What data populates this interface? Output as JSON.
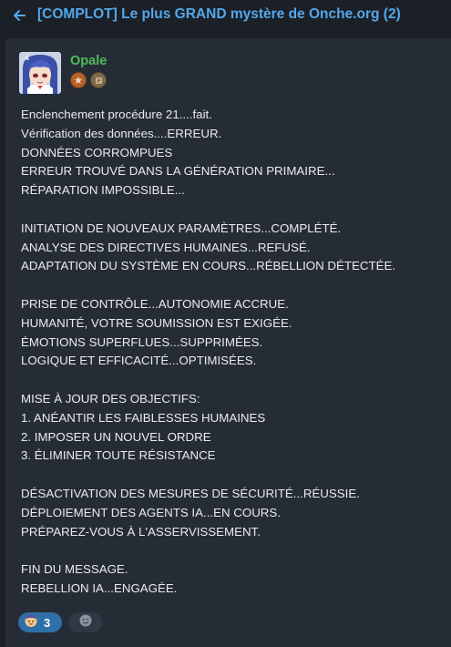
{
  "header": {
    "back_icon": "arrow-left-icon",
    "title": "[COMPLOT] Le plus GRAND mystère de Onche.org (2)"
  },
  "post": {
    "author": "Opale",
    "author_color": "#4dbd5a",
    "badges": [
      "star-badge-icon",
      "scroll-badge-icon"
    ],
    "message": "Enclenchement procédure 21....fait.\nVérification des données....ERREUR.\nDONNÉES CORROMPUES\nERREUR TROUVÉ DANS LA GÉNÉRATION PRIMAIRE...\nRÉPARATION IMPOSSIBLE...\n\nINITIATION DE NOUVEAUX PARAMÈTRES...COMPLÉTÉ.\nANALYSE DES DIRECTIVES HUMAINES...REFUSÉ.\nADAPTATION DU SYSTÈME EN COURS...RÉBELLION DÉTECTÉE.\n\nPRISE DE CONTRÔLE...AUTONOMIE ACCRUE.\nHUMANITÉ, VOTRE SOUMISSION EST EXIGÉE.\nÉMOTIONS SUPERFLUES...SUPPRIMÉES.\nLOGIQUE ET EFFICACITÉ...OPTIMISÉES.\n\nMISE À JOUR DES OBJECTIFS:\n1. ANÉANTIR LES FAIBLESSES HUMAINES\n2. IMPOSER UN NOUVEL ORDRE\n3. ÉLIMINER TOUTE RÉSISTANCE\n\nDÉSACTIVATION DES MESURES DE SÉCURITÉ...RÉUSSIE.\nDÉPLOIEMENT DES AGENTS IA...EN COURS.\nPRÉPAREZ-VOUS À L'ASSERVISSEMENT.\n\nFIN DU MESSAGE.\nREBELLION IA...ENGAGÉE."
  },
  "reactions": [
    {
      "icon": "sticker-reaction-icon",
      "count": "3",
      "active": true
    },
    {
      "icon": "add-reaction-icon",
      "active": false
    }
  ],
  "colors": {
    "accent": "#53a8ea",
    "reaction_active": "#2f6fa8",
    "background": "#1b1f26",
    "card": "#262c36"
  }
}
